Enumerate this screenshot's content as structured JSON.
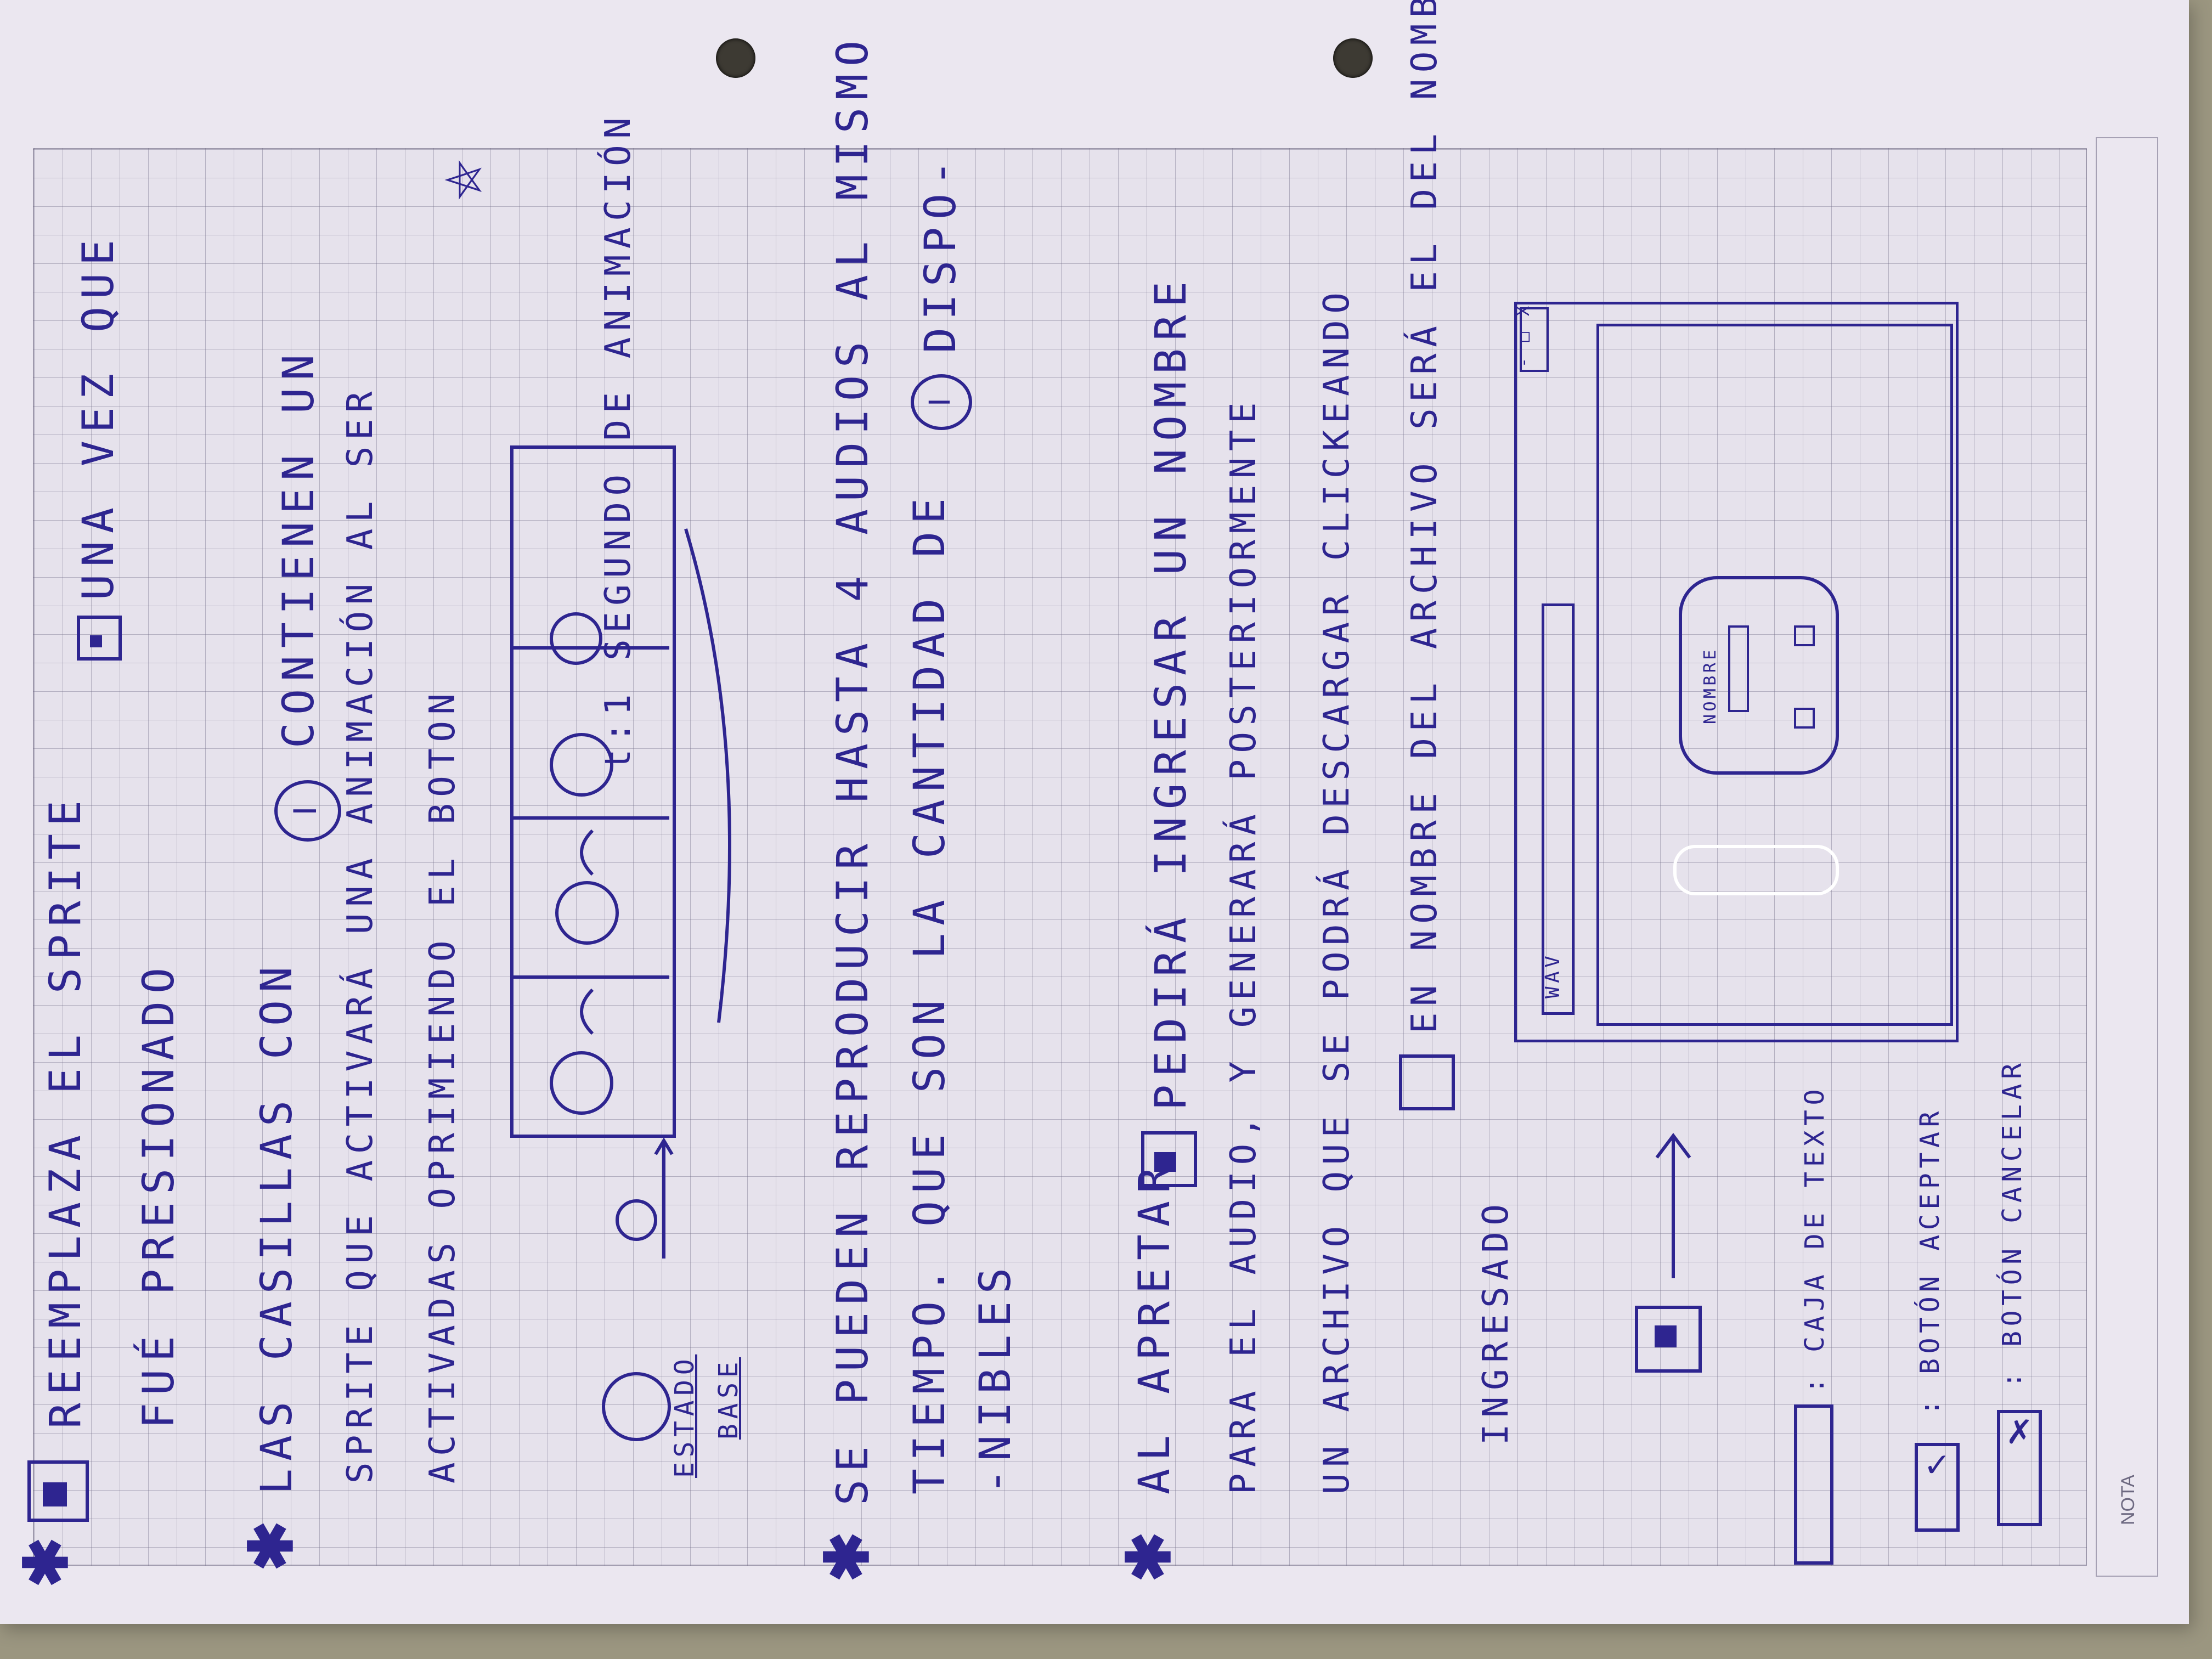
{
  "sheet": {
    "nota_label": "NOTA"
  },
  "note1": {
    "line1": "REEMPLAZA EL SPRITE",
    "line1b": "UNA VEZ QUE",
    "line2": "FUÉ PRESIONADO"
  },
  "note2": {
    "line1": "LAS CASILLAS CON",
    "line1b": "CONTIENEN UN",
    "line2": "SPRITE QUE ACTIVARÁ UNA ANIMACIÓN AL SER",
    "line3": "ACTIVADAS OPRIMIENDO EL BOTON",
    "time_label": "t:1 SEGUNDO DE ANIMACIÓN",
    "base_label_1": "ESTADO",
    "base_label_2": "BASE"
  },
  "note3": {
    "line1": "SE PUEDEN REPRODUCIR HASTA 4 AUDIOS AL MISMO",
    "line2": "TIEMPO. QUE SON LA CANTIDAD DE",
    "line2b": "DISPO-",
    "line3": "-NIBLES"
  },
  "note4": {
    "line1": "AL APRETAR",
    "line1b": "PEDIRÁ INGRESAR UN NOMBRE",
    "line2": "PARA EL AUDIO, Y GENERARÁ POSTERIORMENTE",
    "line3": "UN ARCHIVO QUE SE PODRÁ DESCARGAR CLICKEANDO",
    "line4": "EN NOMBRE DEL ARCHIVO SERÁ EL DEL NOMBRE",
    "line5": "INGRESADO"
  },
  "window_sketch": {
    "corner_button": "- □ X",
    "dialog_label": "NOMBRE",
    "taskbar_label": "WAV"
  },
  "legend": {
    "textbox": ": CAJA DE TEXTO",
    "accept": ": BOTÓN ACEPTAR",
    "cancel": ": BOTÓN CANCELAR"
  }
}
